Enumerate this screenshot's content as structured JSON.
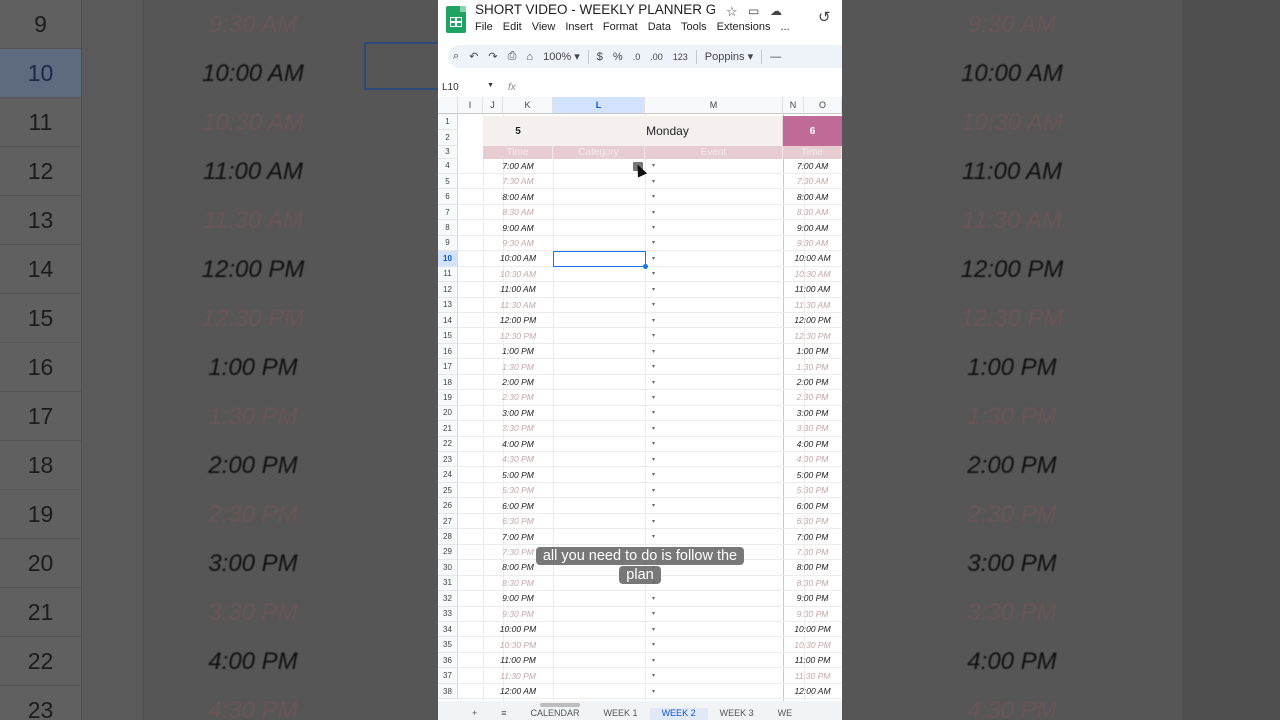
{
  "doc": {
    "title": "SHORT VIDEO - WEEKLY PLANNER GO...",
    "menus": [
      "File",
      "Edit",
      "View",
      "Insert",
      "Format",
      "Data",
      "Tools",
      "Extensions",
      "..."
    ]
  },
  "toolbar": {
    "zoom": "100%",
    "currency": "$",
    "percent": "%",
    "decrease_decimal": ".0",
    "increase_decimal": ".00",
    "number_format": "123",
    "font": "Poppins",
    "minus": "—"
  },
  "formula_bar": {
    "cell_ref": "L10",
    "fx": "fx"
  },
  "columns": [
    "I",
    "J",
    "K",
    "L",
    "M",
    "N",
    "O"
  ],
  "selected_column": "L",
  "row_numbers": [
    "1",
    "2",
    "3",
    "4",
    "5",
    "6",
    "7",
    "8",
    "9",
    "10",
    "11",
    "12",
    "13",
    "14",
    "15",
    "16",
    "17",
    "18",
    "19",
    "20",
    "21",
    "22",
    "23",
    "24",
    "25",
    "26",
    "27",
    "28",
    "29",
    "30",
    "31",
    "32",
    "33",
    "34",
    "35",
    "36",
    "37",
    "38"
  ],
  "selected_row": "10",
  "planner": {
    "day_number": "5",
    "day_name": "Monday",
    "next_day_number": "6",
    "col_labels": {
      "time": "Time",
      "category": "Category",
      "event": "Event",
      "next_time": "Time"
    }
  },
  "times": [
    "7:00 AM",
    "7:30 AM",
    "8:00 AM",
    "8:30 AM",
    "9:00 AM",
    "9:30 AM",
    "10:00 AM",
    "10:30 AM",
    "11:00 AM",
    "11:30 AM",
    "12:00 PM",
    "12:30 PM",
    "1:00 PM",
    "1:30 PM",
    "2:00 PM",
    "2:30 PM",
    "3:00 PM",
    "3:30 PM",
    "4:00 PM",
    "4:30 PM",
    "5:00 PM",
    "5:30 PM",
    "6:00 PM",
    "6:30 PM",
    "7:00 PM",
    "7:30 PM",
    "8:00 PM",
    "8:30 PM",
    "9:00 PM",
    "9:30 PM",
    "10:00 PM",
    "10:30 PM",
    "11:00 PM",
    "11:30 PM",
    "12:00 AM"
  ],
  "dropdown_glyph": "▾",
  "sheet_tabs": [
    "+",
    "≡",
    "CALENDAR",
    "WEEK 1",
    "WEEK 2",
    "WEEK 3",
    "WE"
  ],
  "active_sheet_tab": "WEEK 2",
  "caption": "all you need to do is follow the plan",
  "background": {
    "row_numbers": [
      "9",
      "10",
      "11",
      "12",
      "13",
      "14",
      "15",
      "16",
      "17",
      "18",
      "19",
      "20",
      "21",
      "22",
      "23"
    ],
    "times": [
      "9:30 AM",
      "10:00 AM",
      "10:30 AM",
      "11:00 AM",
      "11:30 AM",
      "12:00 PM",
      "12:30 PM",
      "1:00 PM",
      "1:30 PM",
      "2:00 PM",
      "2:30 PM",
      "3:00 PM",
      "3:30 PM",
      "4:00 PM",
      "4:30 PM"
    ]
  },
  "colors": {
    "accent_pink": "#c06a98",
    "label_row": "#e7cdd1",
    "half_hour_text": "#c6a4a8",
    "selection": "#1a73e8",
    "sheets_green": "#1ea362"
  }
}
